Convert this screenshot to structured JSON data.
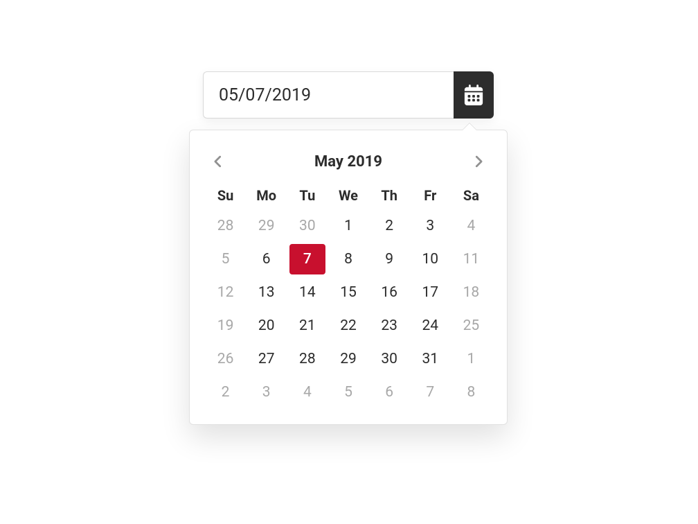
{
  "input": {
    "value": "05/07/2019"
  },
  "calendar": {
    "month_title": "May 2019",
    "days_of_week": [
      "Su",
      "Mo",
      "Tu",
      "We",
      "Th",
      "Fr",
      "Sa"
    ],
    "weeks": [
      [
        {
          "n": "28",
          "muted": true,
          "selected": false
        },
        {
          "n": "29",
          "muted": true,
          "selected": false
        },
        {
          "n": "30",
          "muted": true,
          "selected": false
        },
        {
          "n": "1",
          "muted": false,
          "selected": false
        },
        {
          "n": "2",
          "muted": false,
          "selected": false
        },
        {
          "n": "3",
          "muted": false,
          "selected": false
        },
        {
          "n": "4",
          "muted": true,
          "selected": false
        }
      ],
      [
        {
          "n": "5",
          "muted": true,
          "selected": false
        },
        {
          "n": "6",
          "muted": false,
          "selected": false
        },
        {
          "n": "7",
          "muted": false,
          "selected": true
        },
        {
          "n": "8",
          "muted": false,
          "selected": false
        },
        {
          "n": "9",
          "muted": false,
          "selected": false
        },
        {
          "n": "10",
          "muted": false,
          "selected": false
        },
        {
          "n": "11",
          "muted": true,
          "selected": false
        }
      ],
      [
        {
          "n": "12",
          "muted": true,
          "selected": false
        },
        {
          "n": "13",
          "muted": false,
          "selected": false
        },
        {
          "n": "14",
          "muted": false,
          "selected": false
        },
        {
          "n": "15",
          "muted": false,
          "selected": false
        },
        {
          "n": "16",
          "muted": false,
          "selected": false
        },
        {
          "n": "17",
          "muted": false,
          "selected": false
        },
        {
          "n": "18",
          "muted": true,
          "selected": false
        }
      ],
      [
        {
          "n": "19",
          "muted": true,
          "selected": false
        },
        {
          "n": "20",
          "muted": false,
          "selected": false
        },
        {
          "n": "21",
          "muted": false,
          "selected": false
        },
        {
          "n": "22",
          "muted": false,
          "selected": false
        },
        {
          "n": "23",
          "muted": false,
          "selected": false
        },
        {
          "n": "24",
          "muted": false,
          "selected": false
        },
        {
          "n": "25",
          "muted": true,
          "selected": false
        }
      ],
      [
        {
          "n": "26",
          "muted": true,
          "selected": false
        },
        {
          "n": "27",
          "muted": false,
          "selected": false
        },
        {
          "n": "28",
          "muted": false,
          "selected": false
        },
        {
          "n": "29",
          "muted": false,
          "selected": false
        },
        {
          "n": "30",
          "muted": false,
          "selected": false
        },
        {
          "n": "31",
          "muted": false,
          "selected": false
        },
        {
          "n": "1",
          "muted": true,
          "selected": false
        }
      ],
      [
        {
          "n": "2",
          "muted": true,
          "selected": false
        },
        {
          "n": "3",
          "muted": true,
          "selected": false
        },
        {
          "n": "4",
          "muted": true,
          "selected": false
        },
        {
          "n": "5",
          "muted": true,
          "selected": false
        },
        {
          "n": "6",
          "muted": true,
          "selected": false
        },
        {
          "n": "7",
          "muted": true,
          "selected": false
        },
        {
          "n": "8",
          "muted": true,
          "selected": false
        }
      ]
    ]
  },
  "colors": {
    "accent": "#c8102e",
    "button_bg": "#2d2d2d"
  }
}
